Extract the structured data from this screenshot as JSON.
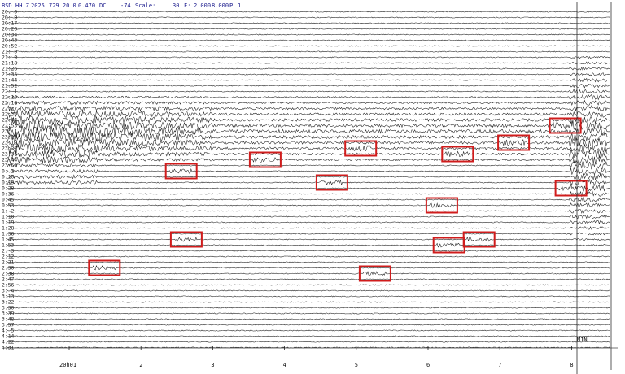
{
  "header": {
    "station": "BSD",
    "channel": "HH Z",
    "year": "2025",
    "day_info": "729 20 0",
    "gain": "0.470",
    "mode": "DC",
    "offset": "-74",
    "scale_label": "Scale:",
    "scale_value": "30",
    "filter_label": "F:",
    "filter_low": "2.000",
    "filter_high": "8.000",
    "filter_mode": "P",
    "filter_order": "1"
  },
  "row_labels": [
    "20: 0",
    "20: 9",
    "20:17",
    "20:26",
    "20:34",
    "20:43",
    "20:52",
    "21: 0",
    "21: 9",
    "21:18",
    "21:26",
    "21:35",
    "21:44",
    "21:52",
    "22: 1",
    "22:10",
    "22:18",
    "22:27",
    "22:35",
    "22:44",
    "22:53",
    "23: 1",
    "23:10",
    "23:19",
    "23:27",
    "23:36",
    "23:44",
    "23:53",
    "0: 2",
    "0:10",
    "0:19",
    "0:28",
    "0:36",
    "0:45",
    "0:53",
    "1: 2",
    "1:10",
    "1:19",
    "1:28",
    "1:36",
    "1:45",
    "1:53",
    "2: 3",
    "2:12",
    "2:21",
    "2:30",
    "2:38",
    "2:47",
    "2:56",
    "3: 4",
    "3:13",
    "3:22",
    "3:30",
    "3:39",
    "3:48",
    "3:57",
    "4: 5",
    "4:14",
    "4:22",
    "4:31"
  ],
  "time_axis": {
    "ticks": [
      "20h01",
      "2",
      "3",
      "4",
      "5",
      "6",
      "7",
      "8"
    ],
    "unit_label": "MIN"
  },
  "event_boxes": [
    {
      "row": 20,
      "minute": 7.9
    },
    {
      "row": 23,
      "minute": 7.18
    },
    {
      "row": 24,
      "minute": 5.05
    },
    {
      "row": 25,
      "minute": 6.4
    },
    {
      "row": 26,
      "minute": 3.72
    },
    {
      "row": 28,
      "minute": 2.55
    },
    {
      "row": 30,
      "minute": 4.65
    },
    {
      "row": 31,
      "minute": 7.98
    },
    {
      "row": 34,
      "minute": 6.18
    },
    {
      "row": 40,
      "minute": 2.62
    },
    {
      "row": 40,
      "minute": 6.7
    },
    {
      "row": 41,
      "minute": 6.28
    },
    {
      "row": 45,
      "minute": 1.48
    },
    {
      "row": 46,
      "minute": 5.25
    }
  ],
  "colors": {
    "header_text": "#1a1a8c",
    "trace": "#1c1c1c",
    "event_box": "#d01c1c",
    "background": "#ffffff"
  }
}
